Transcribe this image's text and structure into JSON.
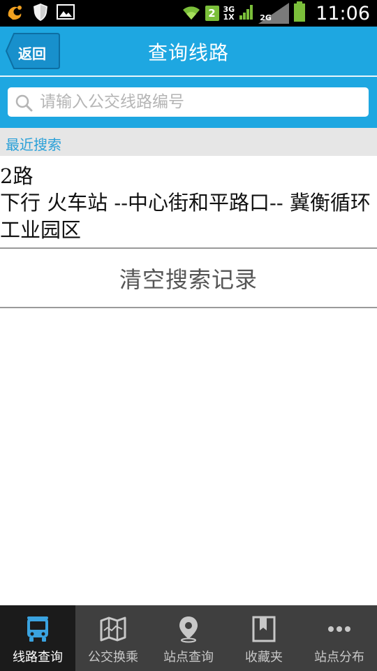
{
  "status_bar": {
    "time": "11:06",
    "sim_number": "2",
    "network_1": "3G",
    "network_1b": "1X",
    "network_2": "2G",
    "icons": [
      "uc-browser-icon",
      "shield-icon",
      "image-icon",
      "wifi-icon",
      "signal-icon",
      "battery-icon"
    ]
  },
  "header": {
    "back_label": "返回",
    "title": "查询线路"
  },
  "search": {
    "placeholder": "请输入公交线路编号",
    "value": ""
  },
  "recent": {
    "section_label": "最近搜索",
    "items": [
      {
        "route": "2路",
        "description": "下行 火车站 --中心街和平路口-- 冀衡循环工业园区"
      }
    ],
    "clear_label": "清空搜索记录"
  },
  "bottom_nav": {
    "items": [
      {
        "label": "线路查询",
        "icon": "bus-icon",
        "active": true
      },
      {
        "label": "公交换乘",
        "icon": "map-icon",
        "active": false
      },
      {
        "label": "站点查询",
        "icon": "location-pin-icon",
        "active": false
      },
      {
        "label": "收藏夹",
        "icon": "bookmark-icon",
        "active": false
      },
      {
        "label": "站点分布",
        "icon": "more-dots-icon",
        "active": false
      }
    ]
  },
  "colors": {
    "accent": "#1ea7e1",
    "nav_bg": "#3f3f3f",
    "nav_active_bg": "#1b1b1b",
    "section_label": "#2aa0d8",
    "bus_icon": "#3aa3e0"
  }
}
